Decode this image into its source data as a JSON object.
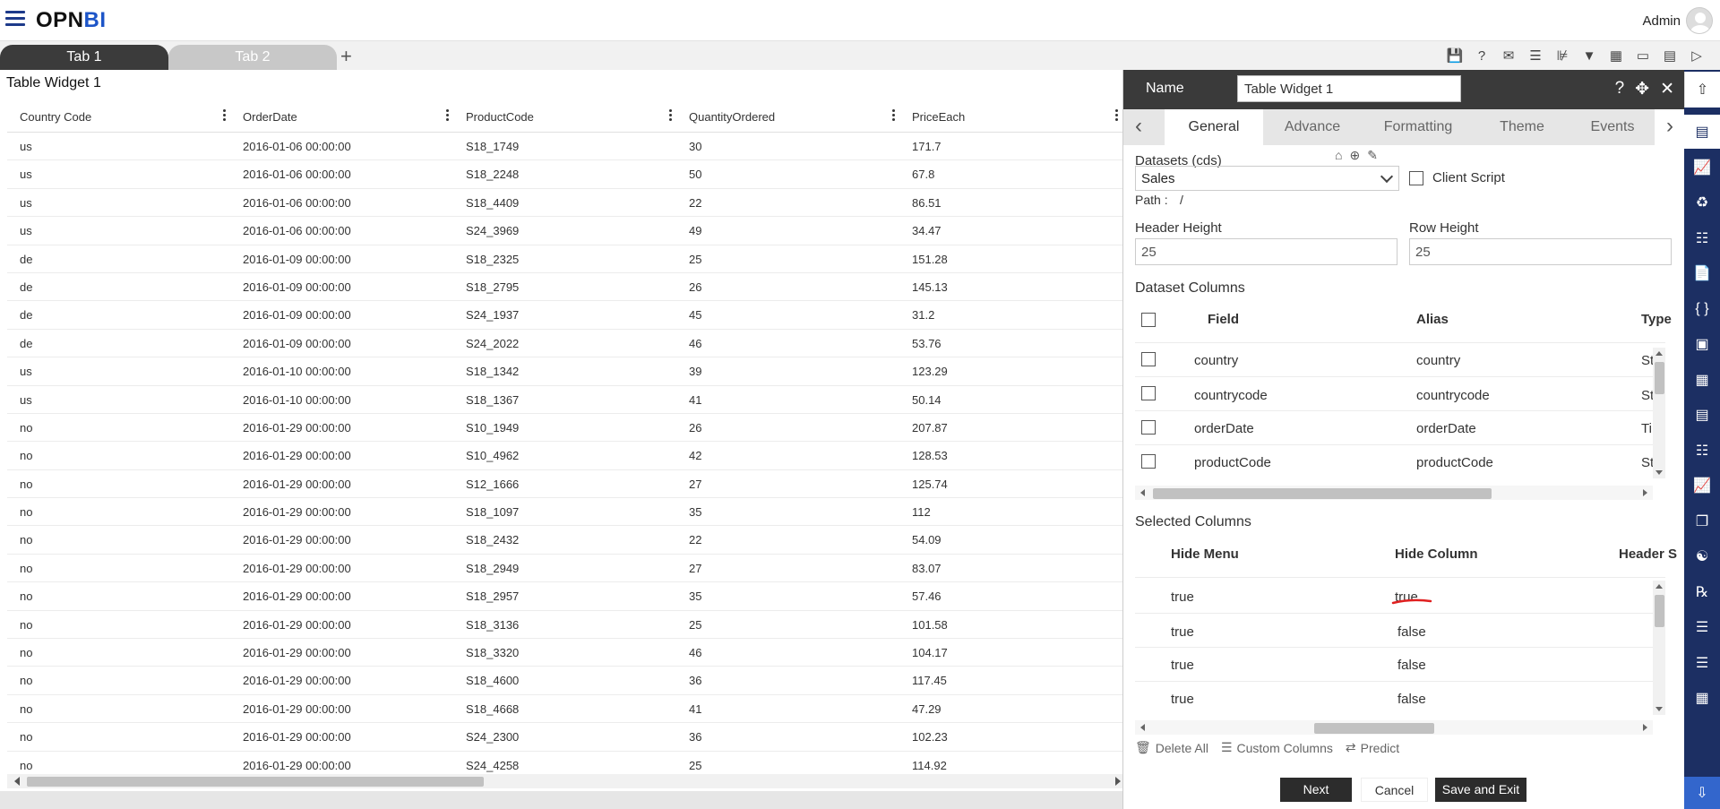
{
  "app": {
    "logo_prefix": "OPN",
    "logo_suffix": "BI",
    "user": "Admin"
  },
  "tabs": [
    {
      "label": "Tab 1"
    },
    {
      "label": "Tab 2"
    }
  ],
  "add_tab_label": "+",
  "toolbar_icons": [
    "save-icon",
    "help-icon",
    "email-icon",
    "comment-icon",
    "clear-filter-icon",
    "filter-icon",
    "table-icon",
    "embed-icon",
    "device-icon",
    "play-icon"
  ],
  "widget": {
    "title": "Table Widget 1",
    "columns": [
      "Country Code",
      "OrderDate",
      "ProductCode",
      "QuantityOrdered",
      "PriceEach"
    ],
    "rows": [
      [
        "us",
        "2016-01-06 00:00:00",
        "S18_1749",
        "30",
        "171.7"
      ],
      [
        "us",
        "2016-01-06 00:00:00",
        "S18_2248",
        "50",
        "67.8"
      ],
      [
        "us",
        "2016-01-06 00:00:00",
        "S18_4409",
        "22",
        "86.51"
      ],
      [
        "us",
        "2016-01-06 00:00:00",
        "S24_3969",
        "49",
        "34.47"
      ],
      [
        "de",
        "2016-01-09 00:00:00",
        "S18_2325",
        "25",
        "151.28"
      ],
      [
        "de",
        "2016-01-09 00:00:00",
        "S18_2795",
        "26",
        "145.13"
      ],
      [
        "de",
        "2016-01-09 00:00:00",
        "S24_1937",
        "45",
        "31.2"
      ],
      [
        "de",
        "2016-01-09 00:00:00",
        "S24_2022",
        "46",
        "53.76"
      ],
      [
        "us",
        "2016-01-10 00:00:00",
        "S18_1342",
        "39",
        "123.29"
      ],
      [
        "us",
        "2016-01-10 00:00:00",
        "S18_1367",
        "41",
        "50.14"
      ],
      [
        "no",
        "2016-01-29 00:00:00",
        "S10_1949",
        "26",
        "207.87"
      ],
      [
        "no",
        "2016-01-29 00:00:00",
        "S10_4962",
        "42",
        "128.53"
      ],
      [
        "no",
        "2016-01-29 00:00:00",
        "S12_1666",
        "27",
        "125.74"
      ],
      [
        "no",
        "2016-01-29 00:00:00",
        "S18_1097",
        "35",
        "112"
      ],
      [
        "no",
        "2016-01-29 00:00:00",
        "S18_2432",
        "22",
        "54.09"
      ],
      [
        "no",
        "2016-01-29 00:00:00",
        "S18_2949",
        "27",
        "83.07"
      ],
      [
        "no",
        "2016-01-29 00:00:00",
        "S18_2957",
        "35",
        "57.46"
      ],
      [
        "no",
        "2016-01-29 00:00:00",
        "S18_3136",
        "25",
        "101.58"
      ],
      [
        "no",
        "2016-01-29 00:00:00",
        "S18_3320",
        "46",
        "104.17"
      ],
      [
        "no",
        "2016-01-29 00:00:00",
        "S18_4600",
        "36",
        "117.45"
      ],
      [
        "no",
        "2016-01-29 00:00:00",
        "S18_4668",
        "41",
        "47.29"
      ],
      [
        "no",
        "2016-01-29 00:00:00",
        "S24_2300",
        "36",
        "102.23"
      ],
      [
        "no",
        "2016-01-29 00:00:00",
        "S24_4258",
        "25",
        "114.92"
      ]
    ]
  },
  "panel": {
    "name_label": "Name",
    "name_value": "Table Widget 1",
    "tabs": [
      "General",
      "Advance",
      "Formatting",
      "Theme",
      "Events"
    ],
    "active_tab": "General",
    "datasets_label": "Datasets (cds)",
    "dataset_value": "Sales",
    "client_script_label": "Client Script",
    "path_label": "Path :",
    "path_value": "/",
    "header_height_label": "Header Height",
    "header_height_value": "25",
    "row_height_label": "Row Height",
    "row_height_value": "25",
    "dataset_columns_label": "Dataset Columns",
    "dataset_columns_headers": [
      "Field",
      "Alias",
      "Type"
    ],
    "dataset_columns_rows": [
      {
        "field": "country",
        "alias": "country",
        "type": "St"
      },
      {
        "field": "countrycode",
        "alias": "countrycode",
        "type": "St"
      },
      {
        "field": "orderDate",
        "alias": "orderDate",
        "type": "Ti"
      },
      {
        "field": "productCode",
        "alias": "productCode",
        "type": "St"
      }
    ],
    "selected_columns_label": "Selected Columns",
    "selected_columns_headers": [
      "Hide Menu",
      "Hide Column",
      "Header S"
    ],
    "selected_columns_rows": [
      {
        "hide_menu": "true",
        "hide_column": "true"
      },
      {
        "hide_menu": "true",
        "hide_column": "false"
      },
      {
        "hide_menu": "true",
        "hide_column": "false"
      },
      {
        "hide_menu": "true",
        "hide_column": "false"
      }
    ],
    "actions": [
      "Delete All",
      "Custom Columns",
      "Predict"
    ],
    "buttons": {
      "next": "Next",
      "cancel": "Cancel",
      "save_exit": "Save and Exit"
    },
    "annotation_color": "#e02020"
  },
  "sidebar_icons": [
    "properties-icon",
    "chart-icon",
    "map-icon",
    "report-icon",
    "document-icon",
    "code-icon",
    "image-icon",
    "pivot-icon",
    "text-icon",
    "tree-icon",
    "line-chart-icon",
    "copy-icon",
    "cluster-icon",
    "formula-icon",
    "notes-icon",
    "layers-icon",
    "widgets-icon"
  ],
  "colors": {
    "sidebar": "#1c2f63",
    "header_dark": "#3a3a3a",
    "brand_blue": "#1d55c8"
  }
}
